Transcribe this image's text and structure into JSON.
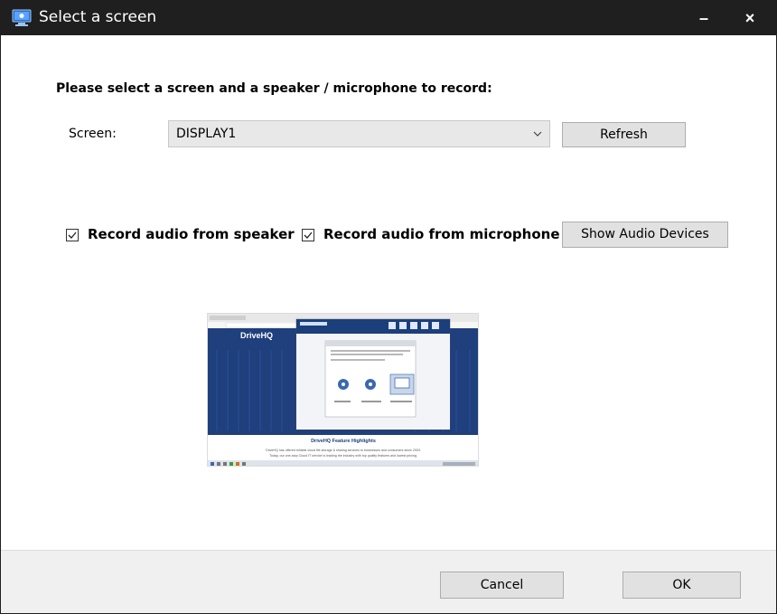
{
  "window": {
    "title": "Select a screen",
    "minimize_label": "–",
    "close_label": "×"
  },
  "instruction": "Please select a screen and a speaker / microphone to record:",
  "screen": {
    "label": "Screen:",
    "selected": "DISPLAY1",
    "refresh_label": "Refresh"
  },
  "audio": {
    "speaker_label": "Record audio from speaker",
    "speaker_checked": true,
    "mic_label": "Record audio from microphone",
    "mic_checked": true,
    "show_devices_label": "Show Audio Devices"
  },
  "preview": {
    "site_logo": "DriveHQ",
    "heading": "DriveHQ Feature Highlights",
    "line1": "DriveHQ has offered reliable cloud file storage & sharing services to businesses and consumers since 2003.",
    "line2": "Today, our one-stop Cloud IT service is leading the industry with top quality features and lowest pricing."
  },
  "footer": {
    "cancel_label": "Cancel",
    "ok_label": "OK"
  },
  "colors": {
    "titlebar": "#1f1f1f",
    "button_bg": "#e1e1e1",
    "footer_bg": "#f0f0f0",
    "preview_header": "#1b3f7a"
  },
  "icons": [
    "app-screen-icon",
    "chevron-down-icon",
    "checkmark-icon"
  ]
}
